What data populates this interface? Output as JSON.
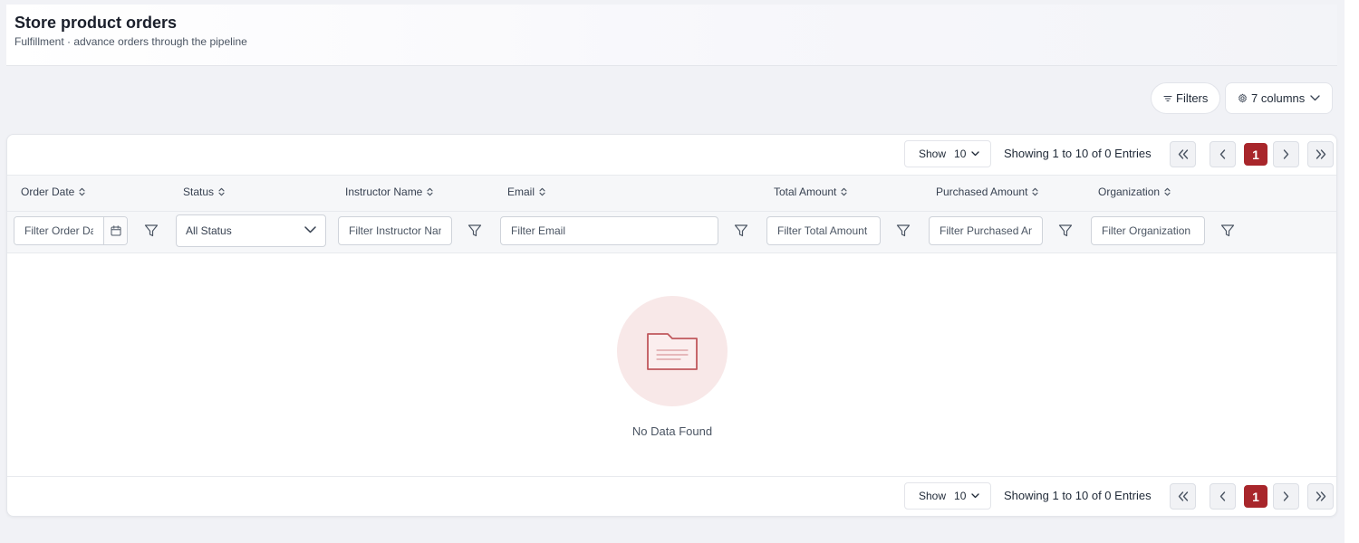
{
  "header": {
    "title": "Store product orders",
    "subtitle": "Fulfillment · advance orders through the pipeline"
  },
  "toolbar": {
    "filters_label": "Filters",
    "columns_label": "7 columns"
  },
  "pagination": {
    "show_label": "Show",
    "page_size": "10",
    "showing_text": "Showing 1 to 10 of 0 Entries",
    "current_page": "1"
  },
  "columns": [
    {
      "label": "Order Date",
      "placeholder": "Filter Order Date"
    },
    {
      "label": "Status",
      "select_value": "All Status"
    },
    {
      "label": "Instructor Name",
      "placeholder": "Filter Instructor Name"
    },
    {
      "label": "Email",
      "placeholder": "Filter Email"
    },
    {
      "label": "Total Amount",
      "placeholder": "Filter Total Amount"
    },
    {
      "label": "Purchased Amount",
      "placeholder": "Filter Purchased Amount"
    },
    {
      "label": "Organization",
      "placeholder": "Filter Organization"
    }
  ],
  "empty_state": {
    "message": "No Data Found",
    "icon": "folder-icon"
  },
  "colors": {
    "accent": "#a8262b",
    "empty_circle": "#f8e8e8"
  }
}
